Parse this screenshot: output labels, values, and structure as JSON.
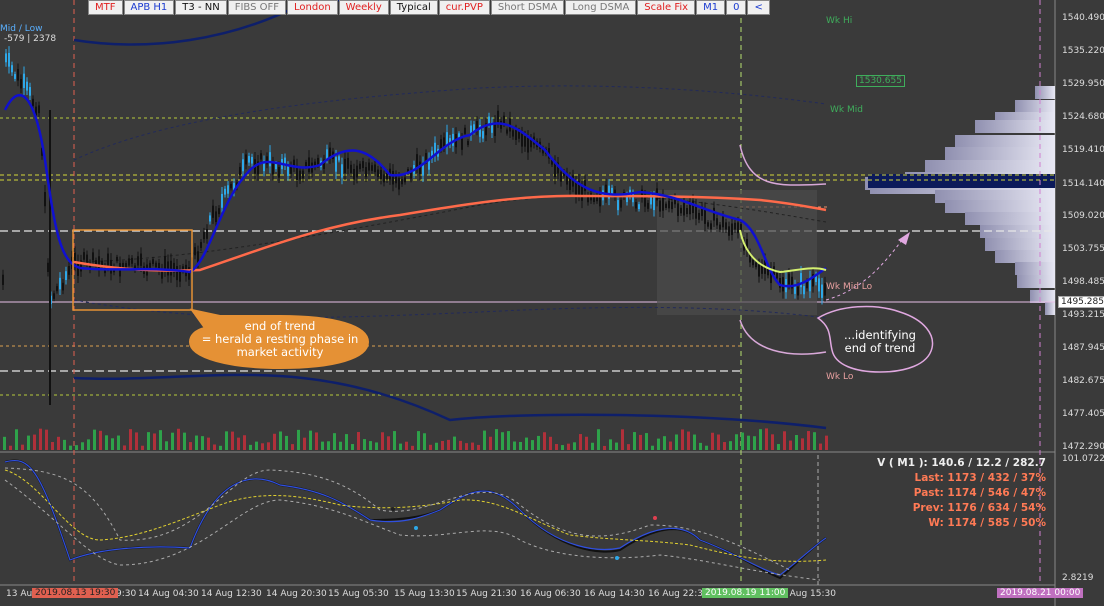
{
  "toolbar": {
    "buttons": [
      {
        "label": "MTF",
        "color": "red"
      },
      {
        "label": "APB H1",
        "color": "blue"
      },
      {
        "label": "T3 - NN",
        "color": "black"
      },
      {
        "label": "FIBS OFF",
        "color": "grey"
      },
      {
        "label": "London",
        "color": "red"
      },
      {
        "label": "Weekly",
        "color": "red"
      },
      {
        "label": "Typical",
        "color": "black"
      },
      {
        "label": "cur.PVP",
        "color": "red"
      },
      {
        "label": "Short DSMA",
        "color": "grey"
      },
      {
        "label": "Long DSMA",
        "color": "grey"
      },
      {
        "label": "Scale Fix",
        "color": "red"
      },
      {
        "label": "M1",
        "color": "blue"
      },
      {
        "label": "0",
        "color": "blue"
      },
      {
        "label": "<",
        "color": "blue"
      }
    ]
  },
  "top_left": {
    "label": "Mid / Low",
    "values": "-579   |  2378"
  },
  "price_axis": {
    "ticks": [
      "1540.490",
      "1535.220",
      "1529.950",
      "1524.680",
      "1519.410",
      "1514.140",
      "1509.020",
      "1503.755",
      "1498.485",
      "1493.215",
      "1487.945",
      "1482.675",
      "1477.405",
      "1472.290"
    ],
    "current_price": "1495.285",
    "osc_ticks": [
      "101.0722",
      "2.8219"
    ]
  },
  "levels": {
    "wk_hi": "Wk Hi",
    "wk_mid": "Wk Mid",
    "wk_mid_lo": "Wk Mid Lo",
    "wk_lo": "Wk Lo",
    "pvp_price": "1530.655"
  },
  "annotations": {
    "end_of_trend": [
      "end of trend",
      "= herald a resting phase in",
      "market activity"
    ],
    "identifying": [
      "...identifying",
      "end of trend"
    ]
  },
  "oscillator_stats": {
    "title": "V ( M1 ): 140.6 / 12.2 / 282.7",
    "last": "Last: 1173 / 432 / 37%",
    "past": "Past: 1174 / 546 / 47%",
    "prev": "Prev: 1176 / 634 / 54%",
    "w": "W: 1174 / 585 / 50%"
  },
  "time_axis": {
    "ticks": [
      "13 Au",
      "9:30",
      "14 Aug 04:30",
      "14 Aug 12:30",
      "14 Aug 20:30",
      "15 Aug 05:30",
      "15 Aug 13:30",
      "15 Aug 21:30",
      "16 Aug 06:30",
      "16 Aug 14:30",
      "16 Aug 22:3",
      "9 Aug 15:30"
    ],
    "highlight_left": "2019.08.13 19:30",
    "highlight_mid": "2019.08.19 11:00",
    "highlight_right": "2019.08.21 00:00"
  },
  "colors": {
    "background": "#3a3a3a",
    "candle": "#111111",
    "candle_up": "#2ea8e8",
    "trend_blue": "#1010d0",
    "dsma_red": "#ff6a4a",
    "annotation_orange": "#e59135",
    "annotation_pink": "#e0a8e0",
    "stat_orange": "#ff7a55"
  }
}
